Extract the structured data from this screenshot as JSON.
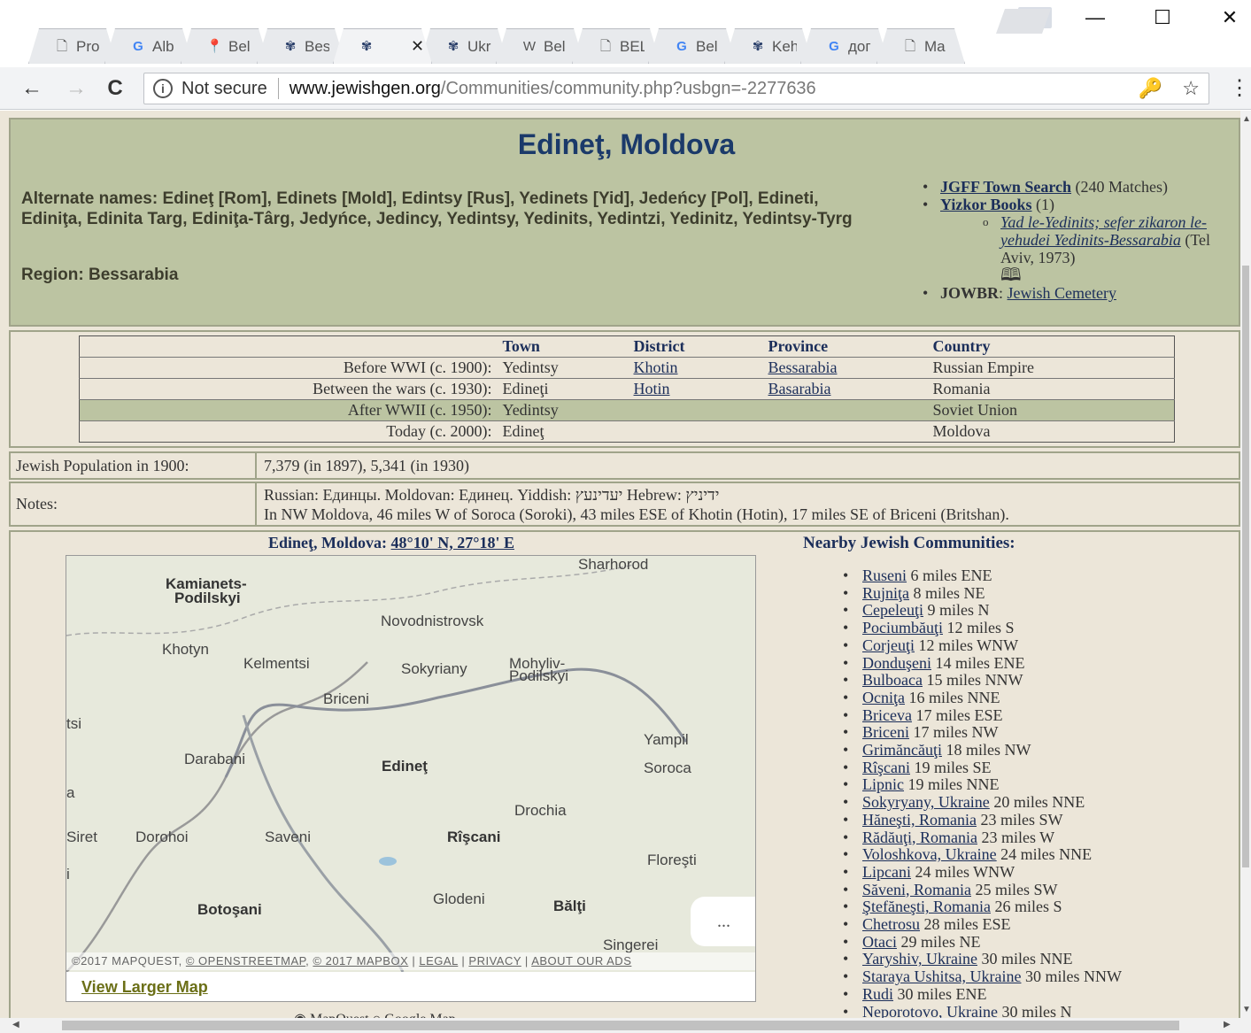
{
  "browser": {
    "tabs": [
      {
        "icon": "page-icon",
        "glyph": "🗋",
        "title": "Pro"
      },
      {
        "icon": "google-icon",
        "glyph": "G",
        "title": "Alb"
      },
      {
        "icon": "maps-icon",
        "glyph": "📍",
        "title": "Bel"
      },
      {
        "icon": "jewishgen-icon",
        "glyph": "✾",
        "title": "Bes"
      },
      {
        "icon": "jewishgen-icon",
        "glyph": "✾",
        "title": ""
      },
      {
        "icon": "jewishgen-icon",
        "glyph": "✾",
        "title": "Ukr"
      },
      {
        "icon": "wikipedia-icon",
        "glyph": "W",
        "title": "Bel"
      },
      {
        "icon": "page-icon",
        "glyph": "🗋",
        "title": "BEL"
      },
      {
        "icon": "google-icon",
        "glyph": "G",
        "title": "Bel"
      },
      {
        "icon": "jewishgen-icon",
        "glyph": "✾",
        "title": "Keh"
      },
      {
        "icon": "google-icon",
        "glyph": "G",
        "title": "дог"
      },
      {
        "icon": "page-icon",
        "glyph": "🗋",
        "title": "Ma"
      }
    ],
    "active_tab_close": "✕",
    "window": {
      "minimize": "—",
      "maximize": "☐",
      "close": "✕"
    },
    "nav": {
      "back": "←",
      "forward": "→",
      "reload": "C"
    },
    "omnibox": {
      "info_glyph": "i",
      "security_text": "Not secure",
      "host": "www.jewishgen.org",
      "path": "/Communities/community.php?usbgn=-2277636"
    },
    "icons": {
      "key": "🔑",
      "star": "☆",
      "menu": "⋮"
    }
  },
  "header": {
    "title": "Edineţ, Moldova",
    "alternate_names": "Alternate names: Edineţ [Rom], Edinets [Mold], Edintsy [Rus], Yedinets [Yid], Jedeńcy [Pol], Edineti, Ediniţa, Edinita Targ, Ediniţa-Târg, Jedyńce, Jedincy, Yedintsy, Yedinits, Yedintzi, Yedinitz, Yedintsy-Tyrg",
    "region": "Region: Bessarabia"
  },
  "links": {
    "jgff": {
      "label": "JGFF Town Search",
      "suffix": " (240 Matches)"
    },
    "yizkor": {
      "label": "Yizkor Books",
      "suffix": " (1)"
    },
    "yizkor_book": {
      "label": "Yad le-Yedinits; sefer zikaron le-yehudei Yedinits-Bessarabia",
      "suffix": " (Tel Aviv, 1973)"
    },
    "book_glyph": "🕮",
    "jowbr": {
      "prefix": "JOWBR",
      "label": "Jewish Cemetery"
    }
  },
  "jurisdiction": {
    "headers": [
      "",
      "Town",
      "District",
      "Province",
      "Country"
    ],
    "rows": [
      {
        "label": "Before WWI (c. 1900):",
        "town": "Yedintsy",
        "district": "Khotin",
        "province": "Bessarabia",
        "country": "Russian Empire"
      },
      {
        "label": "Between the wars (c. 1930):",
        "town": "Edineţi",
        "district": "Hotin",
        "province": "Basarabia",
        "country": "Romania"
      },
      {
        "label": "After WWII (c. 1950):",
        "town": "Yedintsy",
        "district": "",
        "province": "",
        "country": "Soviet Union"
      },
      {
        "label": "Today (c. 2000):",
        "town": "Edineţ",
        "district": "",
        "province": "",
        "country": "Moldova"
      }
    ]
  },
  "population": {
    "label": "Jewish Population in 1900:",
    "value": "7,379 (in 1897), 5,341 (in 1930)"
  },
  "notes": {
    "label": "Notes:",
    "line1": "Russian: Единцы. Moldovan: Единец. Yiddish: יעדינעץ Hebrew: ידיניץ",
    "line2": "In NW Moldova, 46 miles W of Soroca (Soroki), 43 miles ESE of Khotin (Hotin), 17 miles SE of Briceni (Britshan)."
  },
  "map": {
    "title_prefix": "Edineţ, Moldova: ",
    "coords": "48°10' N, 27°18' E",
    "labels": [
      "Sharhorod",
      "Kamianets-",
      "Podilskyi",
      "Novodnistrovsk",
      "Khotyn",
      "Kelmentsi",
      "Sokyriany",
      "Mohyliv-",
      "Podilskyi",
      "Briceni",
      "tsi",
      "Yampil",
      "Darabani",
      "Edineţ",
      "Soroca",
      "a",
      "Drochia",
      "Siret",
      "Dorohoi",
      "Saveni",
      "Rîşcani",
      "Floreşti",
      "i",
      "Glodeni",
      "Bălţi",
      "Botoşani",
      "Singerei"
    ],
    "attribution": [
      "©2017 MAPQUEST, ",
      "© OPENSTREETMAP",
      "© 2017 MAPBOX",
      "LEGAL",
      "PRIVACY",
      "ABOUT OUR ADS"
    ],
    "more": "...",
    "larger": "View Larger Map",
    "radios": "◉ MapQuest   ○ Google Map"
  },
  "nearby": {
    "title": "Nearby Jewish Communities:",
    "items": [
      {
        "name": "Ruseni",
        "dist": " 6 miles ENE"
      },
      {
        "name": "Rujniţa",
        "dist": " 8 miles NE"
      },
      {
        "name": "Cepeleuţi",
        "dist": " 9 miles N"
      },
      {
        "name": "Pociumbăuţi",
        "dist": " 12 miles S"
      },
      {
        "name": "Corjeuţi",
        "dist": " 12 miles WNW"
      },
      {
        "name": "Donduşeni",
        "dist": " 14 miles ENE"
      },
      {
        "name": "Bulboaca",
        "dist": " 15 miles NNW"
      },
      {
        "name": "Ocniţa",
        "dist": " 16 miles NNE"
      },
      {
        "name": "Briceva",
        "dist": " 17 miles ESE"
      },
      {
        "name": "Briceni",
        "dist": " 17 miles NW"
      },
      {
        "name": "Grimăncăuţi",
        "dist": " 18 miles NW"
      },
      {
        "name": "Rîşcani",
        "dist": " 19 miles SE"
      },
      {
        "name": "Lipnic",
        "dist": " 19 miles NNE"
      },
      {
        "name": "Sokyryany, Ukraine",
        "dist": " 20 miles NNE"
      },
      {
        "name": "Hăneşti, Romania",
        "dist": " 23 miles SW"
      },
      {
        "name": "Rădăuţi, Romania",
        "dist": " 23 miles W"
      },
      {
        "name": "Voloshkova, Ukraine",
        "dist": " 24 miles NNE"
      },
      {
        "name": "Lipcani",
        "dist": " 24 miles WNW"
      },
      {
        "name": "Săveni, Romania",
        "dist": " 25 miles SW"
      },
      {
        "name": "Ştefăneşti, Romania",
        "dist": " 26 miles S"
      },
      {
        "name": "Chetrosu",
        "dist": " 28 miles ESE"
      },
      {
        "name": "Otaci",
        "dist": " 29 miles NE"
      },
      {
        "name": "Yaryshiv, Ukraine",
        "dist": " 30 miles NNE"
      },
      {
        "name": "Staraya Ushitsa, Ukraine",
        "dist": " 30 miles NNW"
      },
      {
        "name": "Rudi",
        "dist": " 30 miles ENE"
      },
      {
        "name": "Neporotovo, Ukraine",
        "dist": " 30 miles N"
      }
    ]
  },
  "colors": {
    "header_bg": "#bcc4a2",
    "page_bg": "#ece6d9",
    "title": "#1b3a6a",
    "link": "#1b2e5a"
  }
}
